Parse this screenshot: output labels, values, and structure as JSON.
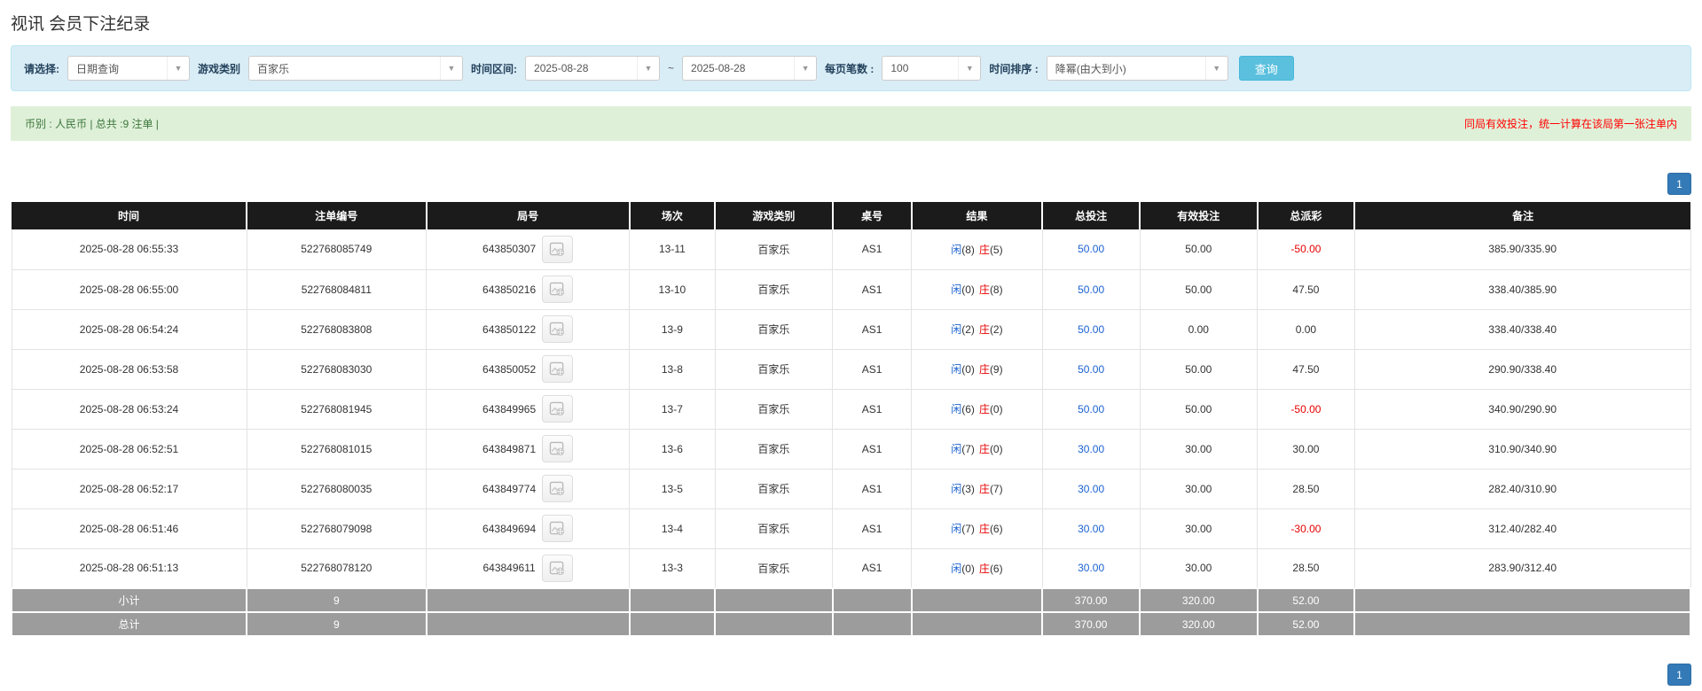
{
  "page": {
    "title": "视讯 会员下注纪录"
  },
  "filters": {
    "select_label": "请选择:",
    "select_value": "日期查询",
    "game_label": "游戏类别",
    "game_value": "百家乐",
    "range_label": "时间区间:",
    "date_from": "2025-08-28",
    "range_separator": "~",
    "date_to": "2025-08-28",
    "page_size_label": "每页笔数 :",
    "page_size_value": "100",
    "sort_label": "时间排序 :",
    "sort_value": "降幂(由大到小)",
    "search_button_label": "查询"
  },
  "summary": {
    "currency_info": "币别 : 人民币 | 总共 :9 注单 |",
    "note": "同局有效投注，统一计算在该局第一张注单内"
  },
  "pagination": {
    "page_label": "1"
  },
  "table": {
    "headers": [
      "时间",
      "注单编号",
      "局号",
      "场次",
      "游戏类别",
      "桌号",
      "结果",
      "总投注",
      "有效投注",
      "总派彩",
      "备注"
    ],
    "rows": [
      {
        "time": "2025-08-28 06:55:33",
        "bet_id": "522768085749",
        "round_id": "643850307",
        "session": "13-11",
        "game": "百家乐",
        "table_no": "AS1",
        "player": "闲",
        "player_score": "(8)",
        "banker": "庄",
        "banker_score": "(5)",
        "total_bet": "50.00",
        "valid_bet": "50.00",
        "payout": "-50.00",
        "remark": "385.90/335.90"
      },
      {
        "time": "2025-08-28 06:55:00",
        "bet_id": "522768084811",
        "round_id": "643850216",
        "session": "13-10",
        "game": "百家乐",
        "table_no": "AS1",
        "player": "闲",
        "player_score": "(0)",
        "banker": "庄",
        "banker_score": "(8)",
        "total_bet": "50.00",
        "valid_bet": "50.00",
        "payout": "47.50",
        "remark": "338.40/385.90"
      },
      {
        "time": "2025-08-28 06:54:24",
        "bet_id": "522768083808",
        "round_id": "643850122",
        "session": "13-9",
        "game": "百家乐",
        "table_no": "AS1",
        "player": "闲",
        "player_score": "(2)",
        "banker": "庄",
        "banker_score": "(2)",
        "total_bet": "50.00",
        "valid_bet": "0.00",
        "payout": "0.00",
        "remark": "338.40/338.40"
      },
      {
        "time": "2025-08-28 06:53:58",
        "bet_id": "522768083030",
        "round_id": "643850052",
        "session": "13-8",
        "game": "百家乐",
        "table_no": "AS1",
        "player": "闲",
        "player_score": "(0)",
        "banker": "庄",
        "banker_score": "(9)",
        "total_bet": "50.00",
        "valid_bet": "50.00",
        "payout": "47.50",
        "remark": "290.90/338.40"
      },
      {
        "time": "2025-08-28 06:53:24",
        "bet_id": "522768081945",
        "round_id": "643849965",
        "session": "13-7",
        "game": "百家乐",
        "table_no": "AS1",
        "player": "闲",
        "player_score": "(6)",
        "banker": "庄",
        "banker_score": "(0)",
        "total_bet": "50.00",
        "valid_bet": "50.00",
        "payout": "-50.00",
        "remark": "340.90/290.90"
      },
      {
        "time": "2025-08-28 06:52:51",
        "bet_id": "522768081015",
        "round_id": "643849871",
        "session": "13-6",
        "game": "百家乐",
        "table_no": "AS1",
        "player": "闲",
        "player_score": "(7)",
        "banker": "庄",
        "banker_score": "(0)",
        "total_bet": "30.00",
        "valid_bet": "30.00",
        "payout": "30.00",
        "remark": "310.90/340.90"
      },
      {
        "time": "2025-08-28 06:52:17",
        "bet_id": "522768080035",
        "round_id": "643849774",
        "session": "13-5",
        "game": "百家乐",
        "table_no": "AS1",
        "player": "闲",
        "player_score": "(3)",
        "banker": "庄",
        "banker_score": "(7)",
        "total_bet": "30.00",
        "valid_bet": "30.00",
        "payout": "28.50",
        "remark": "282.40/310.90"
      },
      {
        "time": "2025-08-28 06:51:46",
        "bet_id": "522768079098",
        "round_id": "643849694",
        "session": "13-4",
        "game": "百家乐",
        "table_no": "AS1",
        "player": "闲",
        "player_score": "(7)",
        "banker": "庄",
        "banker_score": "(6)",
        "total_bet": "30.00",
        "valid_bet": "30.00",
        "payout": "-30.00",
        "remark": "312.40/282.40"
      },
      {
        "time": "2025-08-28 06:51:13",
        "bet_id": "522768078120",
        "round_id": "643849611",
        "session": "13-3",
        "game": "百家乐",
        "table_no": "AS1",
        "player": "闲",
        "player_score": "(0)",
        "banker": "庄",
        "banker_score": "(6)",
        "total_bet": "30.00",
        "valid_bet": "30.00",
        "payout": "28.50",
        "remark": "283.90/312.40"
      }
    ],
    "footer_rows": [
      {
        "label": "小计",
        "count": "9",
        "total_bet": "370.00",
        "valid_bet": "320.00",
        "payout": "52.00"
      },
      {
        "label": "总计",
        "count": "9",
        "total_bet": "370.00",
        "valid_bet": "320.00",
        "payout": "52.00"
      }
    ]
  },
  "colors": {
    "link_blue": "#1b62d0",
    "banker_red": "#e60000",
    "negative_red": "#e60000",
    "header_bg": "#1b1b1b",
    "footer_bg": "#9c9c9c",
    "panel_bg": "#d9edf7",
    "panel_border": "#bce8f1",
    "success_bg": "#dff0d8",
    "success_text": "#3c763d",
    "note_red": "#ff0000",
    "accent_blue": "#337ab7",
    "search_btn_bg": "#5bc0de"
  }
}
